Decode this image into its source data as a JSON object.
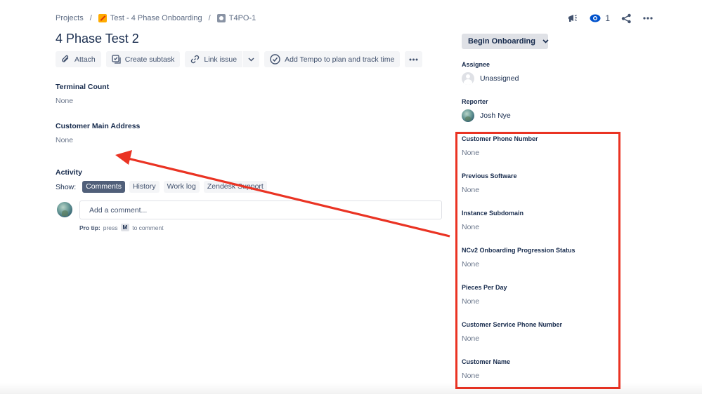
{
  "breadcrumb": {
    "projects": "Projects",
    "project": "Test - 4 Phase Onboarding",
    "issue_key": "T4PO-1",
    "separator": "/"
  },
  "top_actions": {
    "watch_count": "1"
  },
  "issue": {
    "title": "4 Phase Test 2"
  },
  "toolbar": {
    "attach": "Attach",
    "create_subtask": "Create subtask",
    "link_issue": "Link issue",
    "add_tempo": "Add Tempo to plan and track time"
  },
  "fields_left": [
    {
      "label": "Terminal Count",
      "value": "None"
    },
    {
      "label": "Customer Main Address",
      "value": "None"
    }
  ],
  "activity": {
    "title": "Activity",
    "show_label": "Show:",
    "tabs": [
      "Comments",
      "History",
      "Work log",
      "Zendesk Support"
    ],
    "active_tab": "Comments",
    "comment_placeholder": "Add a comment...",
    "protip_label": "Pro tip:",
    "protip_press": "press",
    "protip_key": "M",
    "protip_suffix": "to comment"
  },
  "sidebar": {
    "status_button": "Begin Onboarding",
    "assignee_label": "Assignee",
    "assignee_value": "Unassigned",
    "reporter_label": "Reporter",
    "reporter_value": "Josh Nye",
    "fields": [
      {
        "label": "Customer Phone Number",
        "value": "None"
      },
      {
        "label": "Previous Software",
        "value": "None"
      },
      {
        "label": "Instance Subdomain",
        "value": "None"
      },
      {
        "label": "NCv2 Onboarding Progression Status",
        "value": "None"
      },
      {
        "label": "Pieces Per Day",
        "value": "None"
      },
      {
        "label": "Customer Service Phone Number",
        "value": "None"
      },
      {
        "label": "Customer Name",
        "value": "None"
      }
    ]
  },
  "colors": {
    "annotation_red": "#ea3323",
    "text_primary": "#172b4d",
    "text_muted": "#6b778c",
    "button_bg": "#f4f5f7",
    "active_chip": "#505f79"
  }
}
